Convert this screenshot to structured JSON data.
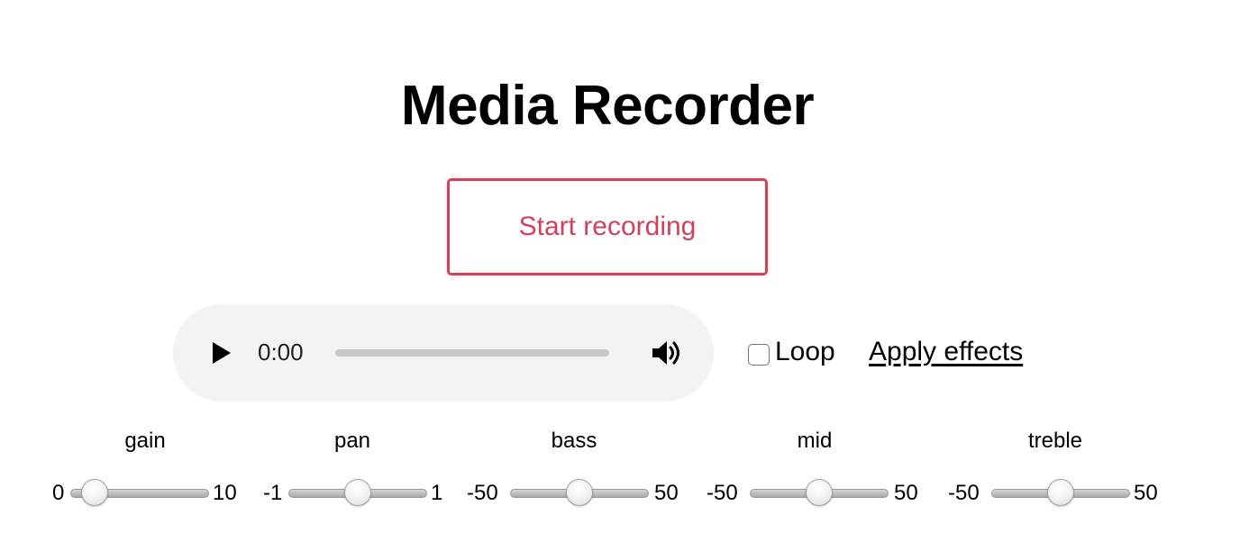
{
  "page": {
    "title": "Media Recorder"
  },
  "recorder": {
    "start_label": "Start recording",
    "accent_color": "#d0415c"
  },
  "player": {
    "time": "0:00",
    "play_icon": "play-icon",
    "volume_icon": "volume-icon"
  },
  "options": {
    "loop_label": "Loop",
    "loop_checked": false,
    "apply_effects_label": "Apply effects"
  },
  "effects": {
    "gain": {
      "label": "gain",
      "min": "0",
      "max": "10",
      "value": 0.5
    },
    "pan": {
      "label": "pan",
      "min": "-1",
      "max": "1",
      "value": 0
    },
    "bass": {
      "label": "bass",
      "min": "-50",
      "max": "50",
      "value": 0
    },
    "mid": {
      "label": "mid",
      "min": "-50",
      "max": "50",
      "value": 0
    },
    "treble": {
      "label": "treble",
      "min": "-50",
      "max": "50",
      "value": 0
    }
  }
}
